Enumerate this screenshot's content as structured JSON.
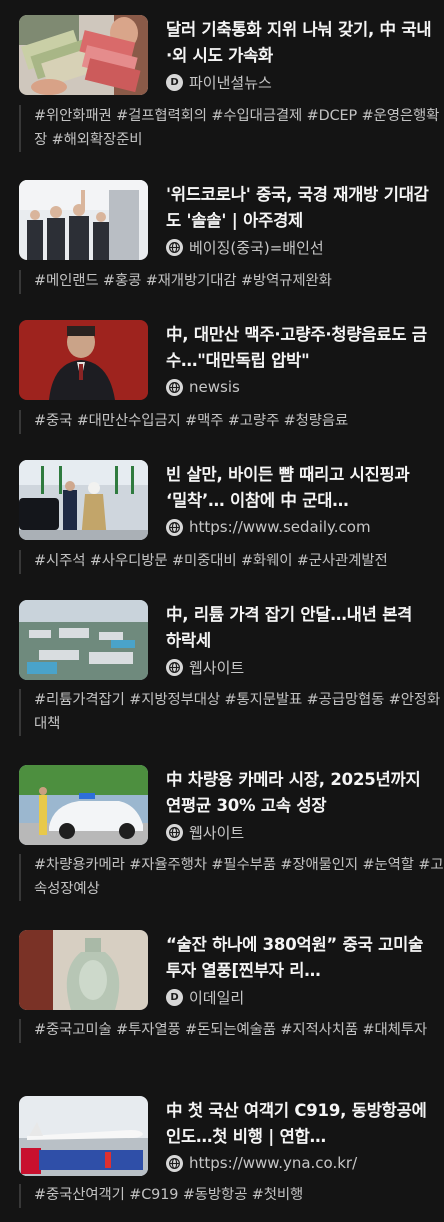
{
  "articles": [
    {
      "title": "달러 기축통화 지위 나눠 갖기, 中 국내·외 시도 가속화",
      "source": "파이낸셜뉴스",
      "source_icon": "publisher-d-icon",
      "tags": "#위안화패권 #걸프협력회의 #수입대금결제 #DCEP #운영은행확장 #해외확장준비"
    },
    {
      "title": "'위드코로나' 중국, 국경 재개방 기대감도 '솔솔' | 아주경제",
      "source": "베이징(중국)=배인선",
      "source_icon": "globe-icon",
      "tags": "#메인랜드 #홍콩 #재개방기대감 #방역규제완화"
    },
    {
      "title": "中, 대만산 맥주·고량주·청량음료도 금수…\"대만독립 압박\"",
      "source": "newsis",
      "source_icon": "globe-icon",
      "tags": "#중국 #대만산수입금지 #맥주 #고량주 #청량음료"
    },
    {
      "title": "빈 살만, 바이든 뺨 때리고 시진핑과 ‘밀착’… 이참에 中 군대…",
      "source": "https://www.sedaily.com",
      "source_icon": "globe-icon",
      "tags": "#시주석 #사우디방문 #미중대비 #화웨이 #군사관계발전"
    },
    {
      "title": "中, 리튬 가격 잡기 안달…내년 본격 하락세",
      "source": "웹사이트",
      "source_icon": "globe-icon",
      "tags": "#리튬가격잡기 #지방정부대상 #통지문발표 #공급망협동 #안정화대책"
    },
    {
      "title": "中 차량용 카메라 시장, 2025년까지 연평균 30% 고속 성장",
      "source": "웹사이트",
      "source_icon": "globe-icon",
      "tags": "#차량용카메라 #자율주행차 #필수부품 #장애물인지 #눈역할 #고속성장예상"
    },
    {
      "title": "“술잔 하나에 380억원” 중국 고미술 투자 열풍[찐부자 리…",
      "source": "이데일리",
      "source_icon": "publisher-d-icon",
      "tags": "#중국고미술 #투자열풍 #돈되는예술품 #지적사치품 #대체투자"
    },
    {
      "title": "中 첫 국산 여객기 C919, 동방항공에 인도…첫 비행 | 연합…",
      "source": "https://www.yna.co.kr/",
      "source_icon": "globe-icon",
      "tags": "#중국산여객기 #C919 #동방항공 #첫비행"
    }
  ]
}
